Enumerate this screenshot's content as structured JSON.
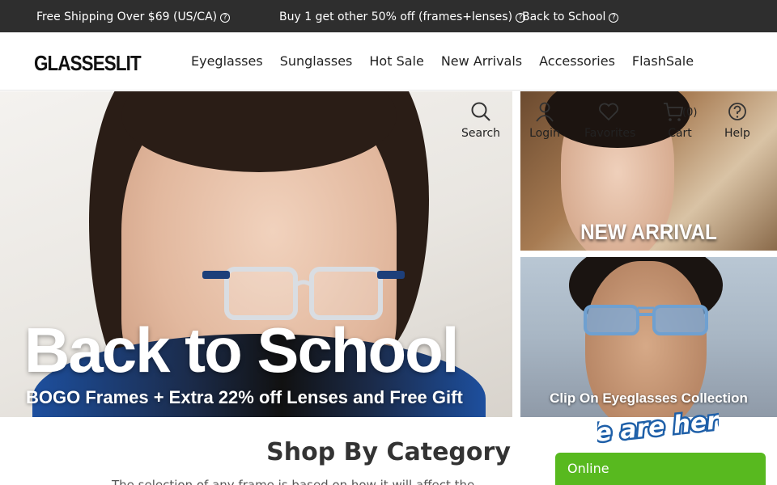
{
  "promo": {
    "item1": "Free Shipping Over $69 (US/CA)",
    "item2": "Buy 1 get other 50% off (frames+lenses)",
    "item3": "Back to School"
  },
  "brand": {
    "logo_text": "GLASSESLIT"
  },
  "nav": {
    "items": [
      "Eyeglasses",
      "Sunglasses",
      "Hot Sale",
      "New Arrivals",
      "Accessories",
      "FlashSale"
    ]
  },
  "utility": {
    "search": "Search",
    "login": "Login",
    "favorites": "Favorites",
    "cart": "Cart",
    "cart_count": "(0)",
    "help": "Help"
  },
  "hero": {
    "title": "Back to School",
    "subtitle": "BOGO Frames + Extra 22% off Lenses and Free Gift"
  },
  "side_banners": {
    "top": "NEW ARRIVAL",
    "bottom": "Clip On Eyeglasses Collection"
  },
  "category": {
    "title": "Shop By Category",
    "description": "The selection of any frame is based on how it will affect the"
  },
  "chat": {
    "badge_text": "We are here!",
    "status": "Online"
  },
  "colors": {
    "promo_bg": "#2e2e2e",
    "chat_green": "#58b91f",
    "badge_blue": "#1e5fa8"
  }
}
